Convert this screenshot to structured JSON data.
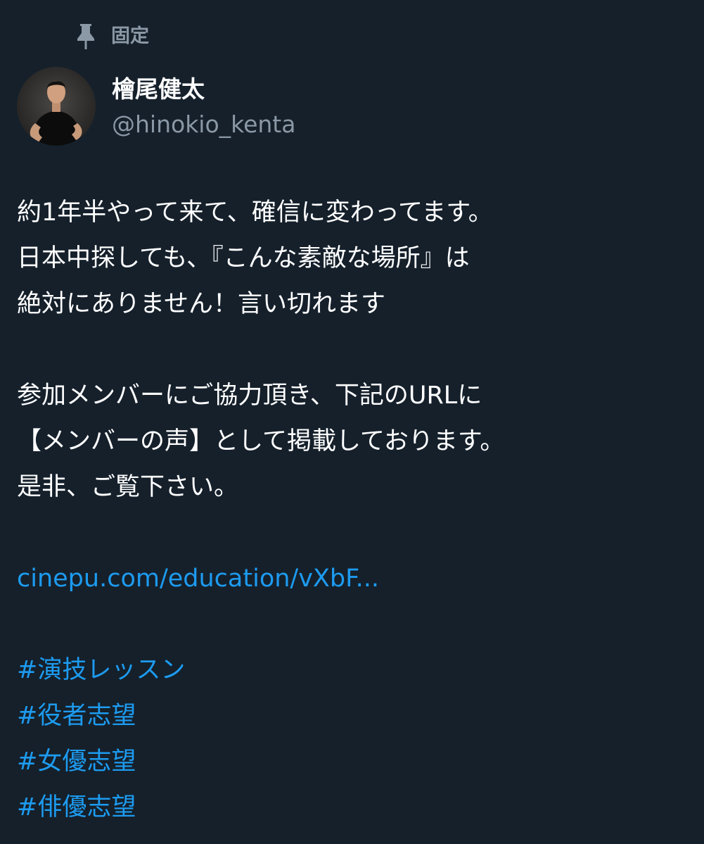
{
  "pinned": {
    "icon": "pin-icon",
    "label": "固定"
  },
  "author": {
    "avatar": "avatar",
    "display_name": "檜尾健太",
    "handle": "@hinokio_kenta"
  },
  "tweet": {
    "paragraph1": [
      "約1年半やって来て、確信に変わってます。",
      "日本中探しても、『こんな素敵な場所』は",
      "絶対にありません！言い切れます"
    ],
    "paragraph2": [
      "参加メンバーにご協力頂き、下記のURLに",
      "【メンバーの声】として掲載しております。",
      "是非、ご覧下さい。"
    ],
    "link": "cinepu.com/education/vXbF...",
    "hashtags": [
      "#演技レッスン",
      "#役者志望",
      "#女優志望",
      "#俳優志望"
    ]
  },
  "colors": {
    "background": "#15202b",
    "secondary_text": "#8b98a5",
    "link": "#1d9bf0"
  }
}
